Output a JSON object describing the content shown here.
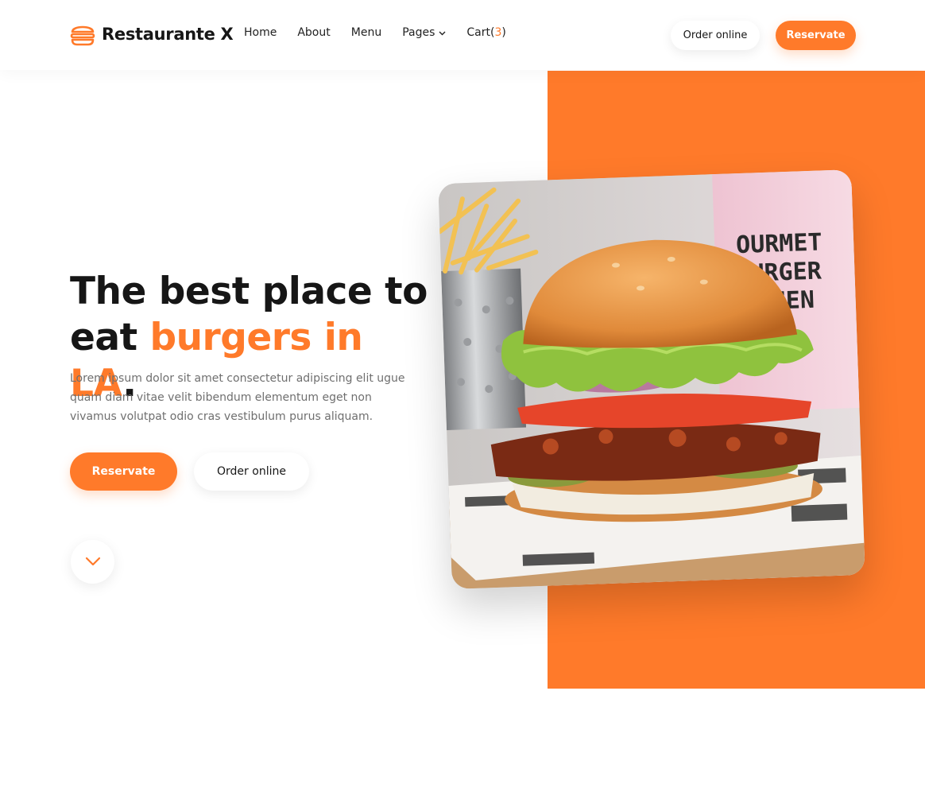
{
  "brand": {
    "name": "Restaurante X",
    "icon": "burger-icon"
  },
  "nav": {
    "items": [
      {
        "label": "Home"
      },
      {
        "label": "About"
      },
      {
        "label": "Menu"
      },
      {
        "label": "Pages",
        "icon": "chevron-down-icon"
      }
    ],
    "cart": {
      "label": "Cart",
      "open": "(",
      "count": "3",
      "close": ")"
    }
  },
  "header_actions": {
    "order_label": "Order online",
    "reserve_label": "Reservate"
  },
  "hero": {
    "title_part1": "The best place to eat ",
    "title_accent": "burgers in LA",
    "title_end": ".",
    "description": "Lorem ipsum dolor sit amet consectetur adipiscing elit ugue quam diam vitae velit bibendum elementum eget non vivamus volutpat odio cras vestibulum purus aliquam.",
    "reserve_label": "Reservate",
    "order_label": "Order online",
    "scroll_icon": "chevron-down-icon",
    "image": {
      "icon": "burger-photo",
      "sign_text": [
        "OURMET",
        "BURGER",
        "TCHEN"
      ]
    }
  },
  "colors": {
    "accent": "#ff7a2a",
    "text": "#161616",
    "muted": "#6f6f6f"
  }
}
